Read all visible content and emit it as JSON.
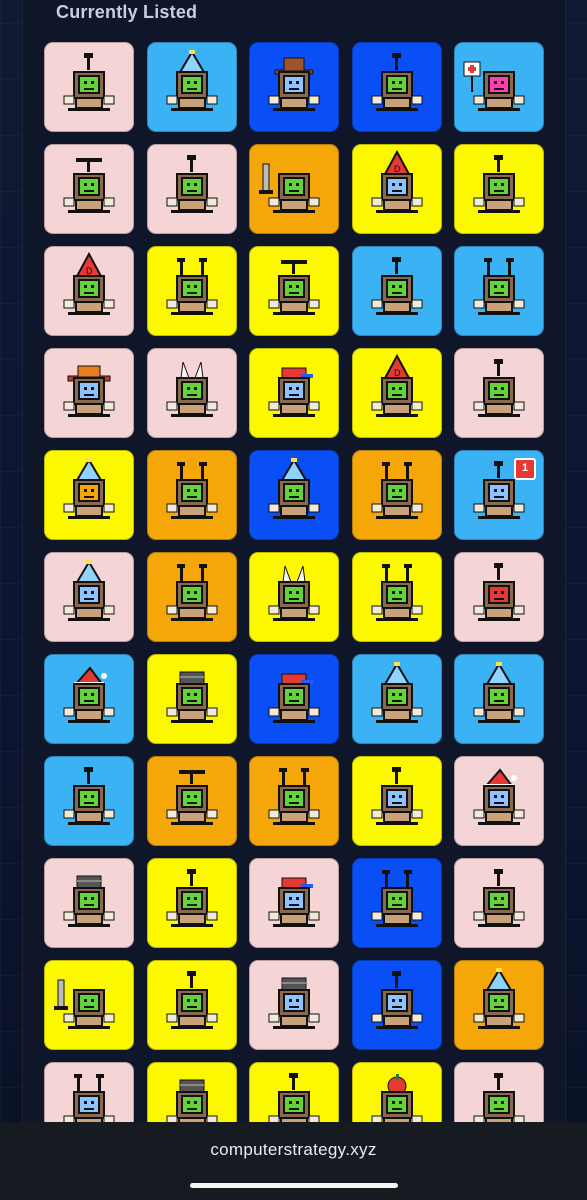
{
  "section": {
    "title": "Currently Listed"
  },
  "palette": {
    "pink": "#f5d4d6",
    "sky": "#3bb2f3",
    "blue": "#0a4ff5",
    "yellow": "#fcf800",
    "orange": "#f5a70a"
  },
  "items": [
    {
      "bg": "#f5d4d6",
      "screen": "#62d43a",
      "hat": "antenna"
    },
    {
      "bg": "#3bb2f3",
      "screen": "#62d43a",
      "hat": "party"
    },
    {
      "bg": "#0a4ff5",
      "screen": "#8fc3ff",
      "hat": "cowboy"
    },
    {
      "bg": "#0a4ff5",
      "screen": "#62d43a",
      "hat": "antenna"
    },
    {
      "bg": "#3bb2f3",
      "screen": "#ff3fb0",
      "hat": "sign"
    },
    {
      "bg": "#f5d4d6",
      "screen": "#62d43a",
      "hat": "propeller"
    },
    {
      "bg": "#f5d4d6",
      "screen": "#62d43a",
      "hat": "antenna"
    },
    {
      "bg": "#f5a70a",
      "screen": "#62d43a",
      "hat": "sword"
    },
    {
      "bg": "#fcf800",
      "screen": "#8fc3ff",
      "hat": "dunce"
    },
    {
      "bg": "#fcf800",
      "screen": "#62d43a",
      "hat": "antenna"
    },
    {
      "bg": "#f5d4d6",
      "screen": "#62d43a",
      "hat": "dunce"
    },
    {
      "bg": "#fcf800",
      "screen": "#62d43a",
      "hat": "antlers"
    },
    {
      "bg": "#fcf800",
      "screen": "#62d43a",
      "hat": "propeller"
    },
    {
      "bg": "#3bb2f3",
      "screen": "#62d43a",
      "hat": "antenna"
    },
    {
      "bg": "#3bb2f3",
      "screen": "#62d43a",
      "hat": "antlers"
    },
    {
      "bg": "#f5d4d6",
      "screen": "#8fc3ff",
      "hat": "sombrero"
    },
    {
      "bg": "#f5d4d6",
      "screen": "#62d43a",
      "hat": "ears"
    },
    {
      "bg": "#fcf800",
      "screen": "#8fc3ff",
      "hat": "cap"
    },
    {
      "bg": "#fcf800",
      "screen": "#62d43a",
      "hat": "dunce"
    },
    {
      "bg": "#f5d4d6",
      "screen": "#62d43a",
      "hat": "antenna"
    },
    {
      "bg": "#fcf800",
      "screen": "#f5a70a",
      "hat": "party"
    },
    {
      "bg": "#f5a70a",
      "screen": "#62d43a",
      "hat": "antlers"
    },
    {
      "bg": "#0a4ff5",
      "screen": "#62d43a",
      "hat": "party"
    },
    {
      "bg": "#f5a70a",
      "screen": "#62d43a",
      "hat": "antlers"
    },
    {
      "bg": "#3bb2f3",
      "screen": "#8fc3ff",
      "hat": "antenna",
      "badge": "1"
    },
    {
      "bg": "#f5d4d6",
      "screen": "#8fc3ff",
      "hat": "party"
    },
    {
      "bg": "#f5a70a",
      "screen": "#62d43a",
      "hat": "antlers"
    },
    {
      "bg": "#fcf800",
      "screen": "#62d43a",
      "hat": "ears"
    },
    {
      "bg": "#fcf800",
      "screen": "#62d43a",
      "hat": "antlers"
    },
    {
      "bg": "#f5d4d6",
      "screen": "#e53935",
      "hat": "antenna"
    },
    {
      "bg": "#3bb2f3",
      "screen": "#62d43a",
      "hat": "santa"
    },
    {
      "bg": "#fcf800",
      "screen": "#62d43a",
      "hat": "beanie"
    },
    {
      "bg": "#0a4ff5",
      "screen": "#62d43a",
      "hat": "cap"
    },
    {
      "bg": "#3bb2f3",
      "screen": "#62d43a",
      "hat": "party"
    },
    {
      "bg": "#3bb2f3",
      "screen": "#62d43a",
      "hat": "party"
    },
    {
      "bg": "#3bb2f3",
      "screen": "#62d43a",
      "hat": "antenna"
    },
    {
      "bg": "#f5a70a",
      "screen": "#62d43a",
      "hat": "propeller"
    },
    {
      "bg": "#f5a70a",
      "screen": "#62d43a",
      "hat": "antlers"
    },
    {
      "bg": "#fcf800",
      "screen": "#8fc3ff",
      "hat": "antenna"
    },
    {
      "bg": "#f5d4d6",
      "screen": "#8fc3ff",
      "hat": "santa"
    },
    {
      "bg": "#f5d4d6",
      "screen": "#62d43a",
      "hat": "beanie"
    },
    {
      "bg": "#fcf800",
      "screen": "#62d43a",
      "hat": "antenna"
    },
    {
      "bg": "#f5d4d6",
      "screen": "#8fc3ff",
      "hat": "cap"
    },
    {
      "bg": "#0a4ff5",
      "screen": "#62d43a",
      "hat": "antlers"
    },
    {
      "bg": "#f5d4d6",
      "screen": "#62d43a",
      "hat": "antenna"
    },
    {
      "bg": "#fcf800",
      "screen": "#62d43a",
      "hat": "sword"
    },
    {
      "bg": "#fcf800",
      "screen": "#62d43a",
      "hat": "antenna"
    },
    {
      "bg": "#f5d4d6",
      "screen": "#8fc3ff",
      "hat": "beanie"
    },
    {
      "bg": "#0a4ff5",
      "screen": "#8fc3ff",
      "hat": "antenna"
    },
    {
      "bg": "#f5a70a",
      "screen": "#62d43a",
      "hat": "party"
    },
    {
      "bg": "#f5d4d6",
      "screen": "#8fc3ff",
      "hat": "antlers"
    },
    {
      "bg": "#fcf800",
      "screen": "#62d43a",
      "hat": "beanie"
    },
    {
      "bg": "#fcf800",
      "screen": "#62d43a",
      "hat": "antenna"
    },
    {
      "bg": "#fcf800",
      "screen": "#62d43a",
      "hat": "fruit"
    },
    {
      "bg": "#f5d4d6",
      "screen": "#62d43a",
      "hat": "antenna"
    }
  ],
  "footer": {
    "url": "computerstrategy.xyz"
  }
}
